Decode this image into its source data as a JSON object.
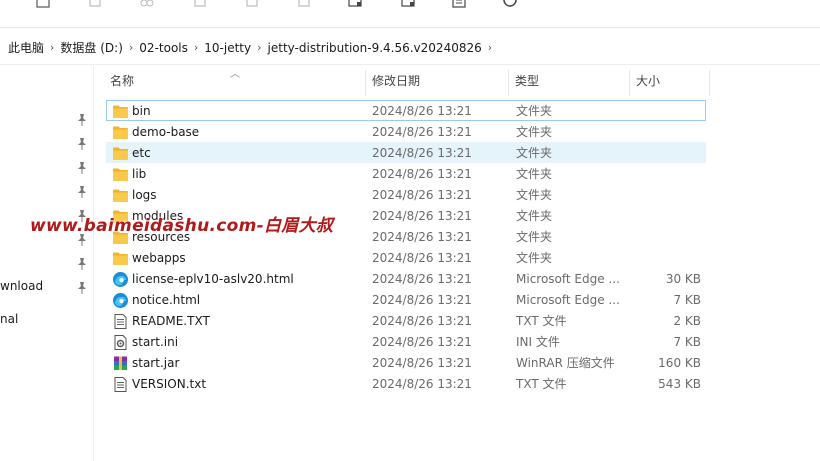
{
  "breadcrumb": [
    "此电脑",
    "数据盘 (D:)",
    "02-tools",
    "10-jetty",
    "jetty-distribution-9.4.56.v20240826"
  ],
  "columns": {
    "name": "名称",
    "date": "修改日期",
    "type": "类型",
    "size": "大小"
  },
  "nav": {
    "item1": "wnload",
    "item2": "nal"
  },
  "watermark": "www.baimeidashu.com-白眉大叔",
  "files": [
    {
      "name": "bin",
      "date": "2024/8/26 13:21",
      "type": "文件夹",
      "size": "",
      "icon": "folder-icon"
    },
    {
      "name": "demo-base",
      "date": "2024/8/26 13:21",
      "type": "文件夹",
      "size": "",
      "icon": "folder-icon"
    },
    {
      "name": "etc",
      "date": "2024/8/26 13:21",
      "type": "文件夹",
      "size": "",
      "icon": "folder-icon"
    },
    {
      "name": "lib",
      "date": "2024/8/26 13:21",
      "type": "文件夹",
      "size": "",
      "icon": "folder-icon"
    },
    {
      "name": "logs",
      "date": "2024/8/26 13:21",
      "type": "文件夹",
      "size": "",
      "icon": "folder-icon"
    },
    {
      "name": "modules",
      "date": "2024/8/26 13:21",
      "type": "文件夹",
      "size": "",
      "icon": "folder-icon"
    },
    {
      "name": "resources",
      "date": "2024/8/26 13:21",
      "type": "文件夹",
      "size": "",
      "icon": "folder-icon"
    },
    {
      "name": "webapps",
      "date": "2024/8/26 13:21",
      "type": "文件夹",
      "size": "",
      "icon": "folder-icon"
    },
    {
      "name": "license-eplv10-aslv20.html",
      "date": "2024/8/26 13:21",
      "type": "Microsoft Edge ...",
      "size": "30 KB",
      "icon": "edge-icon"
    },
    {
      "name": "notice.html",
      "date": "2024/8/26 13:21",
      "type": "Microsoft Edge ...",
      "size": "7 KB",
      "icon": "edge-icon"
    },
    {
      "name": "README.TXT",
      "date": "2024/8/26 13:21",
      "type": "TXT 文件",
      "size": "2 KB",
      "icon": "text-file-icon"
    },
    {
      "name": "start.ini",
      "date": "2024/8/26 13:21",
      "type": "INI 文件",
      "size": "7 KB",
      "icon": "settings-file-icon"
    },
    {
      "name": "start.jar",
      "date": "2024/8/26 13:21",
      "type": "WinRAR 压缩文件",
      "size": "160 KB",
      "icon": "winrar-icon"
    },
    {
      "name": "VERSION.txt",
      "date": "2024/8/26 13:21",
      "type": "TXT 文件",
      "size": "543 KB",
      "icon": "text-file-icon"
    }
  ],
  "colors": {
    "folder": "#f8c94a",
    "focus_border": "#99c9ef",
    "hover": "#e5f3fb",
    "watermark": "#b01a1a",
    "edge": "#1e8bd6"
  }
}
